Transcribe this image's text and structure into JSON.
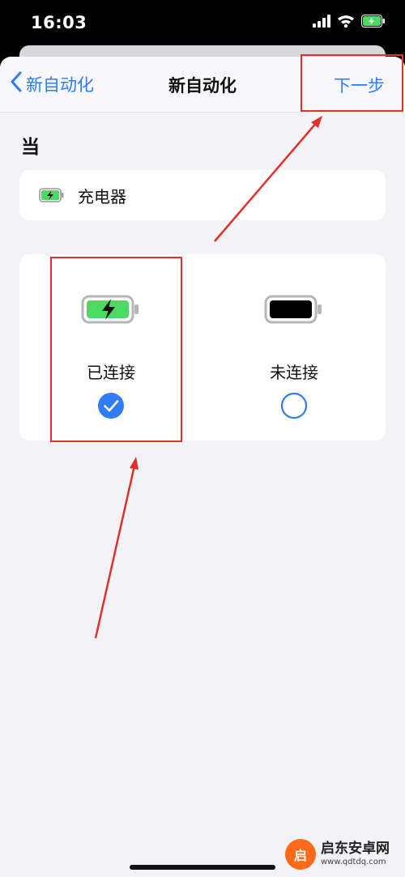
{
  "status_bar": {
    "time": "16:03",
    "icons": [
      "cellular-signal-icon",
      "wifi-icon",
      "battery-charging-icon"
    ]
  },
  "nav": {
    "back_label": "新自动化",
    "title": "新自动化",
    "next_label": "下一步"
  },
  "section": {
    "title": "当"
  },
  "trigger": {
    "icon": "battery-charging-icon",
    "label": "充电器"
  },
  "options": [
    {
      "label": "已连接",
      "icon": "battery-charging-icon",
      "selected": true
    },
    {
      "label": "未连接",
      "icon": "battery-icon",
      "selected": false
    }
  ],
  "annotations": {
    "color": "#e0312b"
  },
  "watermark": {
    "badge": "启",
    "title": "启东安卓网",
    "url": "www.qdtdq.com"
  },
  "colors": {
    "accent": "#2f7cf6",
    "battery_green": "#4cd964",
    "background": "#f2f2f7"
  }
}
